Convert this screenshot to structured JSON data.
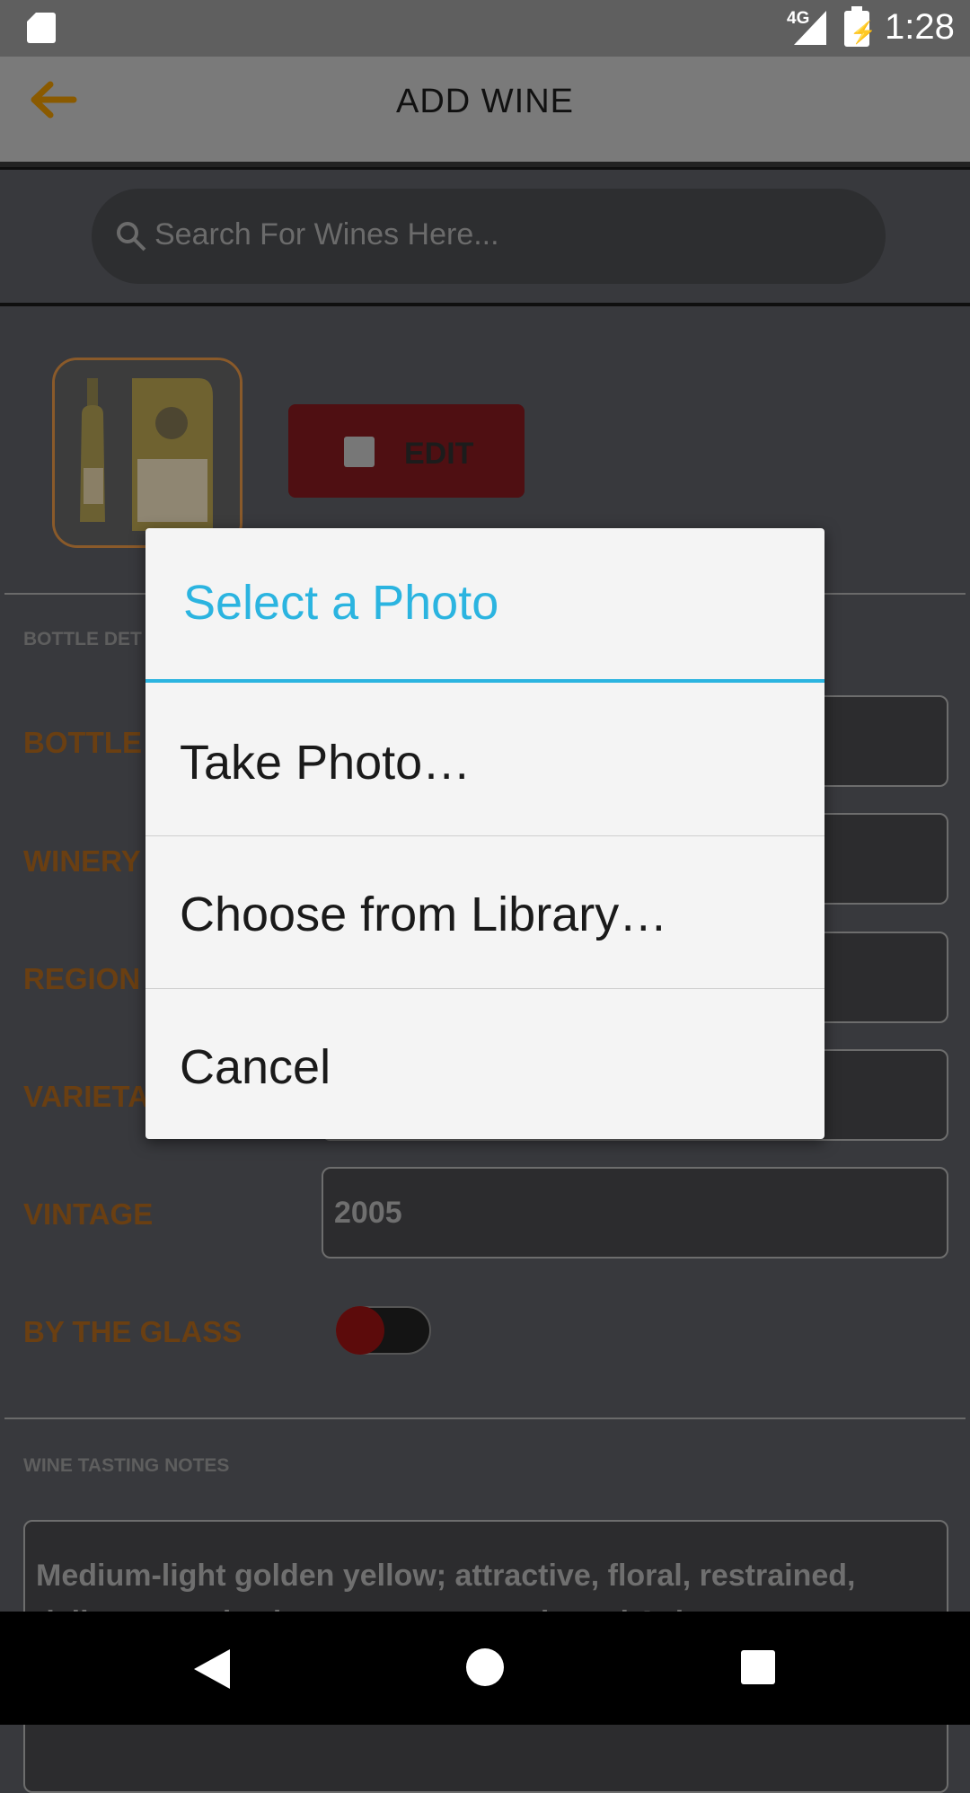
{
  "status_bar": {
    "network": "4G",
    "time": "1:28"
  },
  "header": {
    "title": "ADD WINE",
    "back_icon": "arrow-back-icon"
  },
  "search": {
    "placeholder": "Search For Wines Here..."
  },
  "photo": {
    "edit_label": "EDIT",
    "edit_icon": "image-icon"
  },
  "bottle_details": {
    "section_label": "BOTTLE DET",
    "fields": [
      {
        "label": "BOTTLE",
        "value": ""
      },
      {
        "label": "WINERY",
        "value": ""
      },
      {
        "label": "REGION",
        "value": ""
      },
      {
        "label": "VARIETA",
        "value": ""
      },
      {
        "label": "VINTAGE",
        "value": "2005"
      }
    ],
    "by_the_glass_label": "BY THE GLASS",
    "by_the_glass_on": false
  },
  "tasting_notes": {
    "section_label": "WINE TASTING NOTES",
    "text": "Medium-light golden yellow; attractive, floral, restrained, delicate, earthy, lemony, green apple and Asian pear aroma;"
  },
  "dialog": {
    "title": "Select a Photo",
    "items": [
      "Take Photo…",
      "Choose from Library…",
      "Cancel"
    ]
  },
  "colors": {
    "accent": "#2bb4e0",
    "brand_dark_red": "#4f0f12",
    "label_brown": "#6a3f12"
  }
}
